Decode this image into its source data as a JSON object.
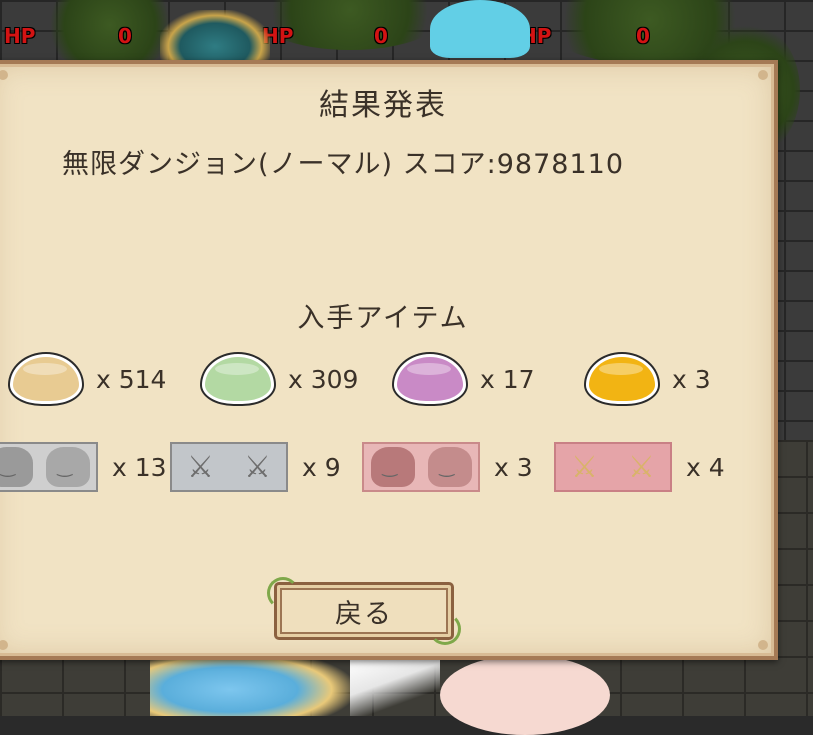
{
  "hud": {
    "hp_label": "HP",
    "players": [
      {
        "hp_label": "HP",
        "hp_value": "0"
      },
      {
        "hp_label": "HP",
        "hp_value": "0"
      },
      {
        "hp_label": "HP",
        "hp_value": "0"
      }
    ]
  },
  "dialog": {
    "title": "結果発表",
    "score_line": "無限ダンジョン(ノーマル) スコア:9878110",
    "items_heading": "入手アイテム",
    "back_button": "戻る"
  },
  "items": {
    "slimes": [
      {
        "icon": "yellow-slime-icon",
        "color": "#e8cb92",
        "count": "x  514"
      },
      {
        "icon": "green-slime-icon",
        "color": "#b3d9a3",
        "count": "x  309"
      },
      {
        "icon": "purple-slime-icon",
        "color": "#c98ac6",
        "count": "x  17"
      },
      {
        "icon": "gold-slime-icon",
        "color": "#f2b413",
        "count": "x  3"
      }
    ],
    "cards": [
      {
        "icon": "gray-character-card-icon",
        "color": "#c9c9c9",
        "count": "x  13"
      },
      {
        "icon": "gray-swords-card-icon",
        "color": "#c2c6ca",
        "count": "x  9"
      },
      {
        "icon": "pink-character-card-icon",
        "color": "#e8b7b7",
        "count": "x  3"
      },
      {
        "icon": "pink-swords-card-icon",
        "color": "#e5a4a8",
        "count": "x  4"
      }
    ]
  }
}
